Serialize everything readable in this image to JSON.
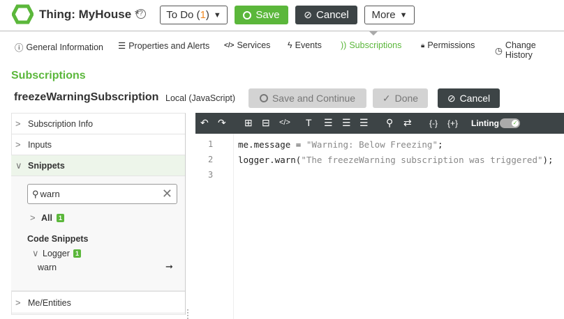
{
  "header": {
    "title": "Thing: MyHouse",
    "modified_mark": "*",
    "todo_label": "To Do (",
    "todo_count": "1",
    "todo_close": ")",
    "save": "Save",
    "cancel": "Cancel",
    "more": "More"
  },
  "tabs": [
    {
      "label": "General Information",
      "icon": "info-icon"
    },
    {
      "label": "Properties and Alerts",
      "icon": "list-icon"
    },
    {
      "label": "Services",
      "icon": "code-icon"
    },
    {
      "label": "Events",
      "icon": "bolt-icon"
    },
    {
      "label": "Subscriptions",
      "icon": "rss-icon",
      "active": true
    },
    {
      "label": "Permissions",
      "icon": "lock-icon"
    },
    {
      "label": "Change History",
      "icon": "clock-icon"
    }
  ],
  "section_title": "Subscriptions",
  "subscription": {
    "name": "freezeWarningSubscription",
    "type": "Local (JavaScript)",
    "save_continue": "Save and Continue",
    "done": "Done",
    "cancel": "Cancel"
  },
  "sidebar": {
    "items": [
      "Subscription Info",
      "Inputs",
      "Snippets",
      "Me/Entities"
    ],
    "search_value": "warn",
    "all_label": "All",
    "all_count": "1",
    "code_snippets": "Code Snippets",
    "logger": "Logger",
    "logger_count": "1",
    "snippet": "warn"
  },
  "editor": {
    "linting": "Linting",
    "linting_on": true,
    "lines": [
      "1",
      "2",
      "3"
    ],
    "line1": {
      "a": "me.message = ",
      "s": "\"Warning: Below Freezing\"",
      "b": ";"
    },
    "line2": {
      "a": "logger.warn(",
      "s": "\"The freezeWarning subscription was triggered\"",
      "b": ");"
    }
  },
  "colors": {
    "accent": "#5bb73b",
    "dark": "#3d4446"
  }
}
